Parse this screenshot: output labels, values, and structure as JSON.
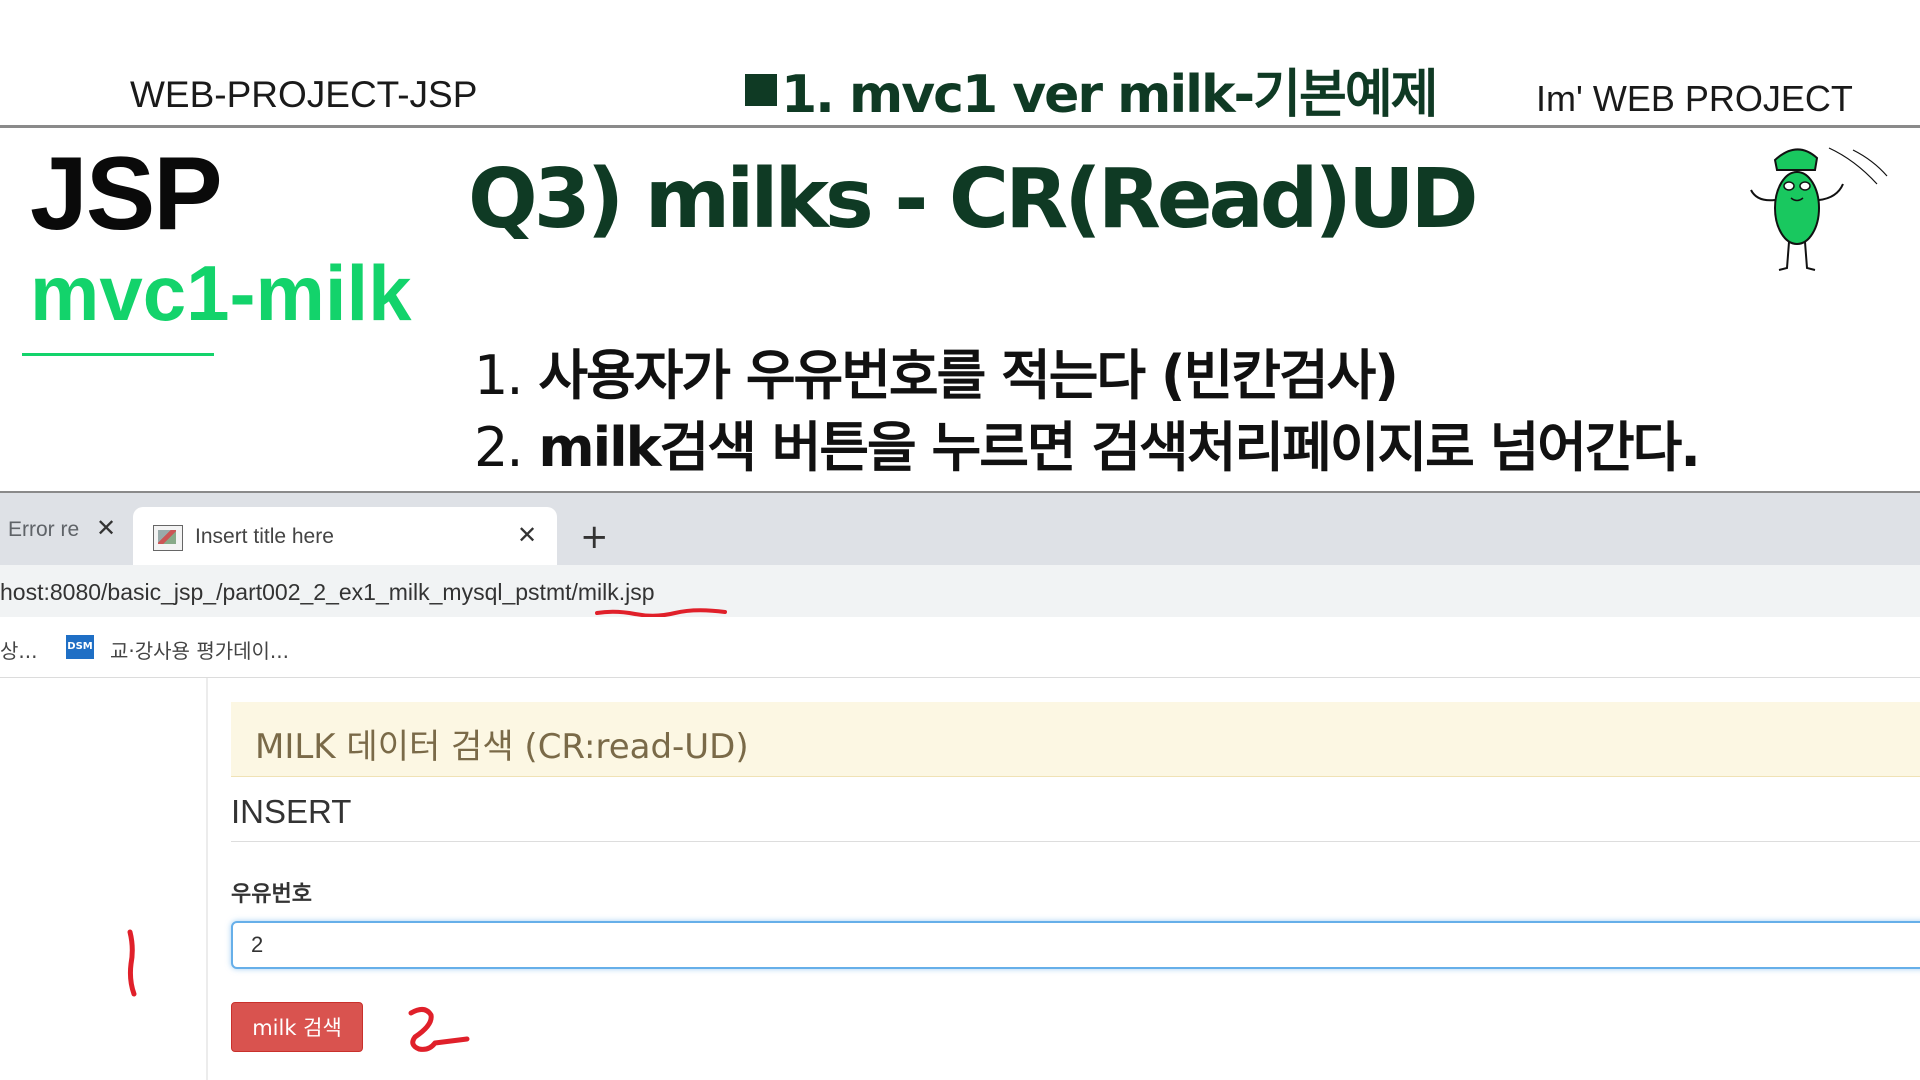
{
  "header": {
    "left": "WEB-PROJECT-JSP",
    "center": "1. mvc1 ver  milk-기본예제",
    "right": "Im'  WEB PROJECT"
  },
  "slide": {
    "title": "JSP",
    "subtitle": "mvc1-milk",
    "question": "Q3) milks - CR(Read)UD",
    "steps": [
      {
        "num": "1.",
        "text": "사용자가 우유번호를 적는다 (빈칸검사)"
      },
      {
        "num": "2.",
        "text": "milk검색 버튼을 누르면 검색처리페이지로 넘어간다."
      }
    ],
    "mascot_icon": "jsp-mascot-icon"
  },
  "browser": {
    "tabs": [
      {
        "label": "Error re",
        "close": "✕"
      },
      {
        "label": "Insert title here",
        "close": "✕"
      }
    ],
    "new_tab": "+",
    "address": "host:8080/basic_jsp_/part002_2_ex1_milk_mysql_pstmt/milk.jsp",
    "bookmarks": [
      {
        "label": "상..."
      },
      {
        "icon_text": "DSM",
        "label": "교·강사용 평가데이..."
      }
    ]
  },
  "page": {
    "banner": "MILK 데이터 검색 (CR:read-UD)",
    "section_title": "INSERT",
    "field_label": "우유번호",
    "field_value": "2",
    "button_label": "milk 검색"
  },
  "colors": {
    "accent_green": "#13d36b",
    "dark_green": "#0f3a24",
    "button_red": "#d9534f",
    "banner_bg": "#fcf7e3",
    "annotation_red": "#e0202a"
  }
}
